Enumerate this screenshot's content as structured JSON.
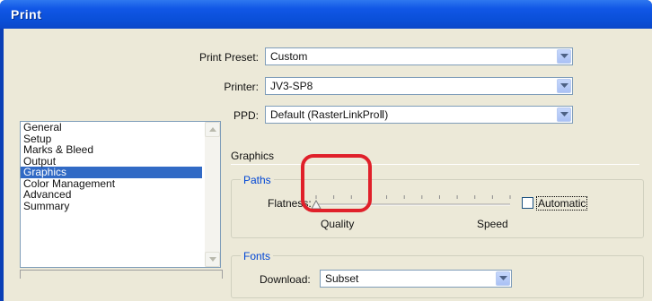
{
  "window": {
    "title": "Print"
  },
  "preset": {
    "label": "Print Preset:",
    "value": "Custom"
  },
  "printer": {
    "label": "Printer:",
    "value": "JV3-SP8"
  },
  "ppd": {
    "label": "PPD:",
    "value": "Default (RasterLinkProⅡ)"
  },
  "categories": {
    "items": [
      "General",
      "Setup",
      "Marks & Bleed",
      "Output",
      "Graphics",
      "Color Management",
      "Advanced",
      "Summary"
    ],
    "selected": "Graphics"
  },
  "graphics": {
    "heading": "Graphics",
    "paths": {
      "legend": "Paths",
      "flatness_label": "Flatness:",
      "min_label": "Quality",
      "max_label": "Speed",
      "slider_value": 0,
      "automatic_label": "Automatic",
      "automatic_checked": false
    },
    "fonts": {
      "legend": "Fonts",
      "download_label": "Download:",
      "download_value": "Subset"
    }
  },
  "colors": {
    "titlebar": "#0a4fd8",
    "selection": "#316ac5",
    "group_legend": "#0046d5",
    "highlight_circle": "#e0202a"
  }
}
